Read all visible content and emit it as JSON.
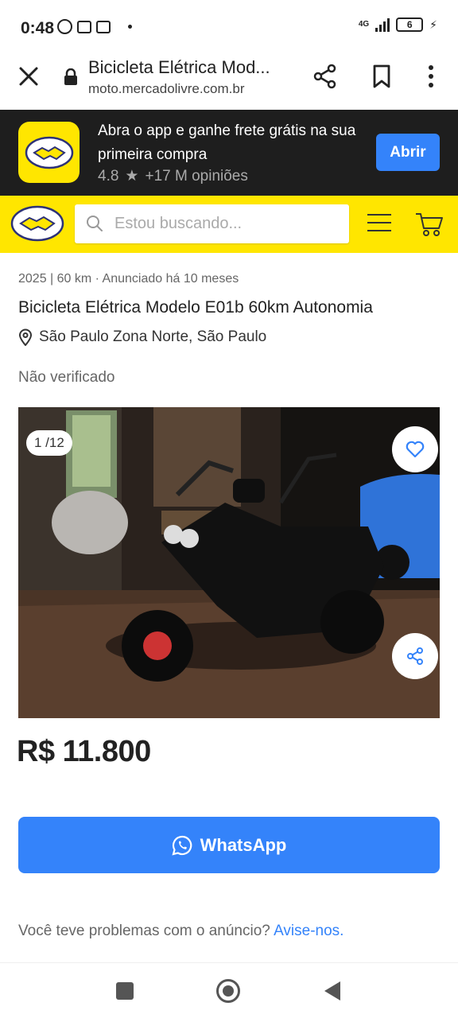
{
  "status_bar": {
    "time": "0:48",
    "network": "4G",
    "battery": "6"
  },
  "browser": {
    "title": "Bicicleta Elétrica Mod...",
    "url": "moto.mercadolivre.com.br"
  },
  "app_banner": {
    "text": "Abra o app e ganhe frete grátis na sua primeira compra",
    "rating": "4.8",
    "reviews": "+17 M opiniões",
    "open_label": "Abrir"
  },
  "header": {
    "search_placeholder": "Estou buscando..."
  },
  "listing": {
    "meta": "2025 | 60 km · Anunciado há 10 meses",
    "title": "Bicicleta Elétrica Modelo E01b 60km Autonomia",
    "location": "São Paulo Zona Norte, São Paulo",
    "verified": "Não verificado",
    "photo_counter": "1 /12",
    "price": "R$ 11.800"
  },
  "actions": {
    "whatsapp_label": "WhatsApp"
  },
  "report": {
    "question": "Você teve problemas com o anúncio? ",
    "link": "Avise-nos."
  },
  "colors": {
    "brand_yellow": "#ffe600",
    "accent_blue": "#3483fa",
    "banner_dark": "#1e1e1e"
  }
}
